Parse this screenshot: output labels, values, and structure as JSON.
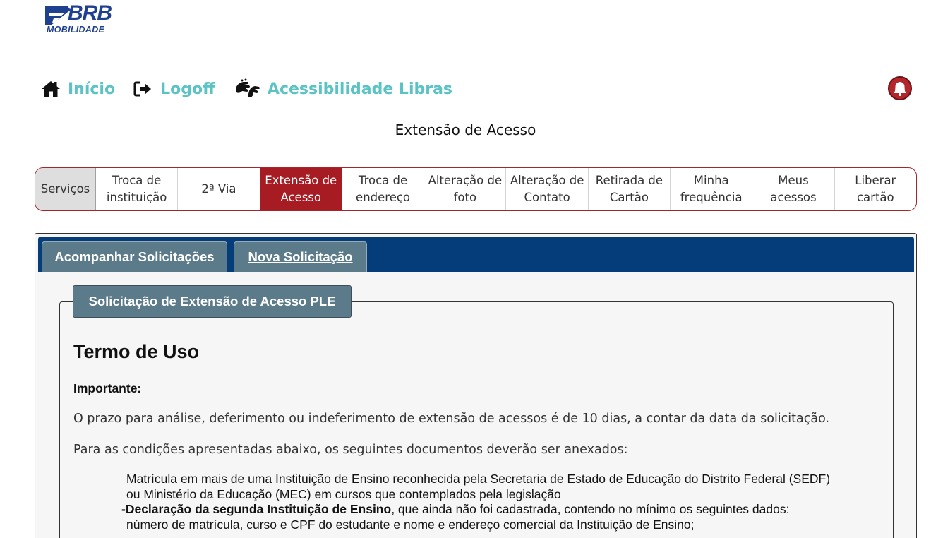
{
  "logo": {
    "brand": "BRB",
    "subtitle": "MOBILIDADE"
  },
  "topnav": [
    {
      "label": "Início",
      "icon": "home-icon"
    },
    {
      "label": "Logoff",
      "icon": "logoff-icon"
    },
    {
      "label": "Acessibilidade Libras",
      "icon": "sign-language-icon"
    }
  ],
  "notification": {
    "icon": "bell-icon"
  },
  "page_title": "Extensão de Acesso",
  "services": [
    {
      "label": "Serviços",
      "line1": "Serviços",
      "line2": ""
    },
    {
      "label": "Troca de instituição",
      "line1": "Troca de",
      "line2": "instituição"
    },
    {
      "label": "2ª Via",
      "line1": "2ª Via",
      "line2": ""
    },
    {
      "label": "Extensão de Acesso",
      "line1": "Extensão de",
      "line2": "Acesso"
    },
    {
      "label": "Troca de endereço",
      "line1": "Troca de",
      "line2": "endereço"
    },
    {
      "label": "Alteração de foto",
      "line1": "Alteração de",
      "line2": "foto"
    },
    {
      "label": "Alteração de Contato",
      "line1": "Alteração de",
      "line2": "Contato"
    },
    {
      "label": "Retirada de Cartão",
      "line1": "Retirada de",
      "line2": "Cartão"
    },
    {
      "label": "Minha frequência",
      "line1": "Minha",
      "line2": "frequência"
    },
    {
      "label": "Meus acessos",
      "line1": "Meus",
      "line2": "acessos"
    },
    {
      "label": "Liberar cartão",
      "line1": "Liberar",
      "line2": "cartão"
    }
  ],
  "active_service": "Extensão de Acesso",
  "tabs": {
    "track": "Acompanhar Solicitações",
    "new": "Nova Solicitação"
  },
  "form": {
    "legend": "Solicitação de Extensão de Acesso PLE",
    "heading": "Termo de Uso",
    "important_label": "Importante:",
    "paragraph1": "O prazo para análise, deferimento ou indeferimento de extensão de acessos é de 10 dias, a contar da data da solicitação.",
    "paragraph2": "Para as condições apresentadas abaixo, os seguintes documentos deverão ser anexados:",
    "item1_line1": "Matrícula em mais de uma Instituição de Ensino reconhecida pela Secretaria de Estado de Educação do Distrito Federal (SEDF)",
    "item1_line2": "ou Ministério da Educação (MEC) em cursos que contemplados pela legislação",
    "item2_bold": "-Declaração da segunda Instituição de Ensino",
    "item2_rest": ", que ainda não foi cadastrada, contendo no mínimo os seguintes dados:",
    "item2_line2": "número de matrícula, curso e CPF do estudante e nome e endereço comercial da Instituição de Ensino;"
  },
  "colors": {
    "brand_blue": "#1f3f8f",
    "nav_teal": "#5cc3c5",
    "active_red": "#a61c22",
    "tabbar_blue": "#053c7a",
    "tab_slate": "#5c7b8a"
  }
}
